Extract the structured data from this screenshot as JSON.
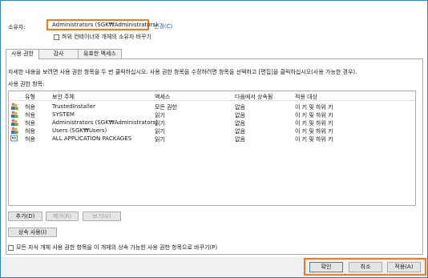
{
  "owner": {
    "label": "소유자:",
    "value": "Administrators (SGK₩Administrators)",
    "change_link": "변경(C)",
    "replace_checkbox_label": "하위 컨테이너와 개체의 소유자 바꾸기"
  },
  "tabs": [
    {
      "label": "사용 권한",
      "active": true
    },
    {
      "label": "감사",
      "active": false
    },
    {
      "label": "유효한 액세스",
      "active": false
    }
  ],
  "description": "자세한 내용을 보려면 사용 권한 항목을 두 번 클릭하십시오. 사용 권한 항목을 수정하려면 항목을 선택하고 [편집]을 클릭하십시오(사용 가능한 경우).",
  "entries_label": "사용 권한 항목:",
  "columns": [
    "유형",
    "보안 주체",
    "액세스",
    "다음에서 상속됨",
    "적용 대상"
  ],
  "rows": [
    {
      "icon": "user-group-icon",
      "type": "허용",
      "principal": "TrustedInstaller",
      "access": "모든 권한",
      "inherited": "없음",
      "applies": "이 키 및 하위 키"
    },
    {
      "icon": "user-group-icon",
      "type": "허용",
      "principal": "SYSTEM",
      "access": "읽기",
      "inherited": "없음",
      "applies": "이 키 및 하위 키"
    },
    {
      "icon": "user-group-icon",
      "type": "허용",
      "principal": "Administrators (SGK₩Administrators)",
      "access": "읽기",
      "inherited": "없음",
      "applies": "이 키 및 하위 키"
    },
    {
      "icon": "user-group-icon",
      "type": "허용",
      "principal": "Users (SGK₩Users)",
      "access": "읽기",
      "inherited": "없음",
      "applies": "이 키 및 하위 키"
    },
    {
      "icon": "package-icon",
      "type": "허용",
      "principal": "ALL APPLICATION PACKAGES",
      "access": "읽기",
      "inherited": "없음",
      "applies": "이 키 및 하위 키"
    }
  ],
  "buttons": {
    "add": "추가(D)",
    "remove": "제거(R)",
    "view": "보기(V)",
    "enable_inheritance": "상속 사용(I)"
  },
  "replace_child_checkbox_label": "모든 자식 개체 사용 권한 항목을 이 개체의 상속 가능한 사용 권한 항목으로 바꾸기(P)",
  "footer": {
    "ok": "확인",
    "cancel": "취소",
    "apply": "적용(A)"
  },
  "colors": {
    "highlight": "#f07a22",
    "link": "#1e5fb4",
    "window_border": "#3c7fb1"
  }
}
